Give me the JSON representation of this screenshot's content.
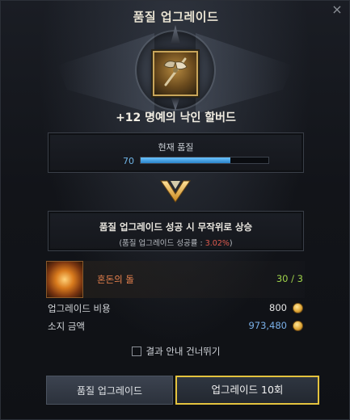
{
  "window": {
    "title": "품질 업그레이드",
    "close_glyph": "×"
  },
  "item": {
    "name": "+12 명예의 낙인 할버드",
    "icon": "halberd-icon"
  },
  "quality": {
    "label": "현재 품질",
    "value": "70",
    "progress": 0.7,
    "color": "#6fb4e6"
  },
  "upgrade_info": {
    "main": "품질 업그레이드 성공 시 무작위로 상승",
    "sub_prefix": "(품질 업그레이드 성공률 : ",
    "sub_rate": "3.02%",
    "sub_suffix": ")"
  },
  "material": {
    "name": "혼돈의 돌",
    "count": "30 / 3",
    "icon": "chaos-stone-icon"
  },
  "costs": [
    {
      "label": "업그레이드 비용",
      "value": "800",
      "icon": "gold-coin-icon"
    },
    {
      "label": "소지 금액",
      "value": "973,480",
      "icon": "gold-coin-icon"
    }
  ],
  "skip_result": {
    "label": "결과 안내 건너뛰기",
    "checked": false
  },
  "buttons": {
    "quality_upgrade": "품질 업그레이드",
    "upgrade_10": "업그레이드 10회"
  },
  "colors": {
    "highlight_border": "#e4c33e",
    "rate": "#e05a4e",
    "material_name": "#e8824d",
    "material_count": "#9fd24a"
  }
}
